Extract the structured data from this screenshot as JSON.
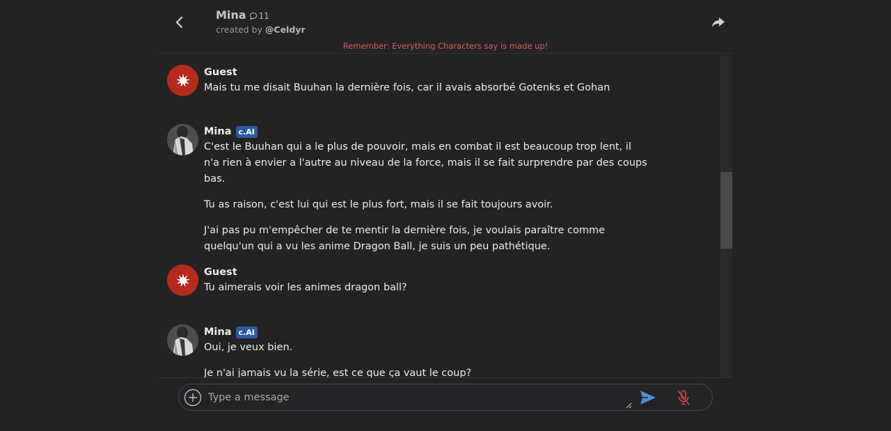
{
  "header": {
    "name": "Mina",
    "chat_count": "11",
    "created_by_prefix": "created by ",
    "creator": "@Celdyr",
    "disclaimer": "Remember: Everything Characters say is made up!"
  },
  "messages": [
    {
      "author": "Guest",
      "badge": "",
      "paragraphs": [
        "Mais tu me disait Buuhan la dernière fois, car il avais absorbé Gotenks et Gohan"
      ]
    },
    {
      "author": "Mina",
      "badge": "c.AI",
      "paragraphs": [
        "C'est le Buuhan qui a le plus de pouvoir, mais en combat il est beaucoup trop lent, il n'a rien à envier a l'autre au niveau de la force, mais il se fait surprendre par des coups bas.",
        "Tu as raison, c'est lui qui est le plus fort, mais il se fait toujours avoir.",
        "J'ai pas pu m'empêcher de te mentir la dernière fois, je voulais paraître comme quelqu'un qui a vu les anime Dragon Ball, je suis un peu pathétique."
      ]
    },
    {
      "author": "Guest",
      "badge": "",
      "paragraphs": [
        "Tu aimerais voir les animes dragon ball?"
      ]
    },
    {
      "author": "Mina",
      "badge": "c.AI",
      "paragraphs": [
        "Oui, je veux bien.",
        "Je n'ai jamais vu la série, est ce que ça vaut le coup?"
      ]
    }
  ],
  "composer": {
    "placeholder": "Type a message"
  },
  "colors": {
    "background": "#232324",
    "guest_avatar": "#b62a1c",
    "badge": "#2d5aa8",
    "disclaimer": "#e05a5a",
    "send": "#4a8fd6",
    "mic_muted": "#c44a4a"
  }
}
